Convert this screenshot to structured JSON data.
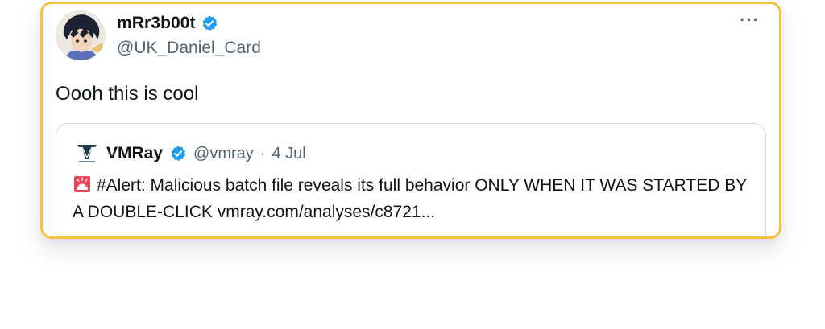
{
  "tweet": {
    "display_name": "mRr3b00t",
    "handle": "@UK_Daniel_Card",
    "more_label": "···",
    "text": "Oooh this is cool",
    "icons": {
      "avatar": "user-avatar",
      "verified": "verified-badge-icon",
      "more": "more-options-icon"
    }
  },
  "quote": {
    "display_name": "VMRay",
    "handle": "@vmray",
    "separator": "·",
    "date": "4 Jul",
    "text": "#Alert: Malicious batch file reveals its full behavior ONLY WHEN IT WAS STARTED BY A DOUBLE-CLICK vmray.com/analyses/c8721...",
    "icons": {
      "logo": "vmray-logo-icon",
      "verified": "verified-badge-icon",
      "siren": "rotating-light-icon"
    }
  },
  "colors": {
    "highlight_border": "#f5c242",
    "verified_blue": "#1d9bf0",
    "secondary_text": "#536471"
  }
}
